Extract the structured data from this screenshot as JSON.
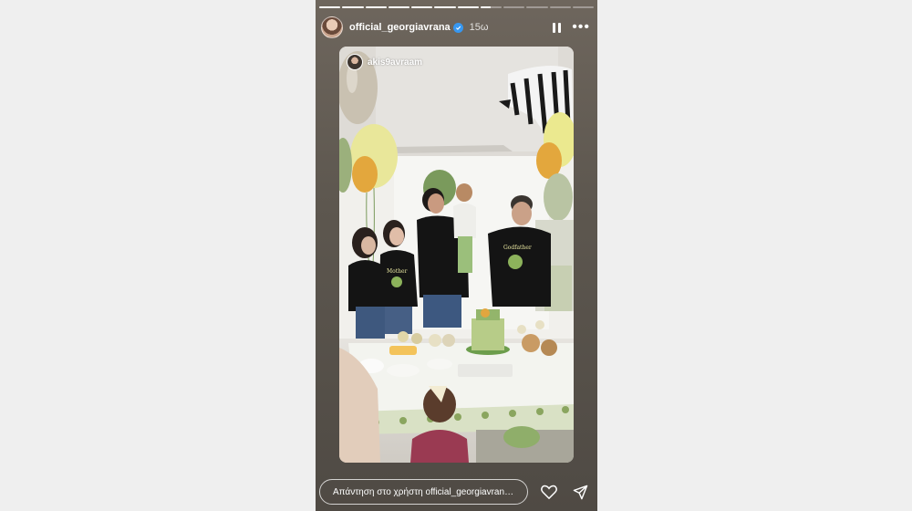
{
  "story": {
    "progress_segments": [
      1,
      1,
      1,
      1,
      1,
      1,
      1,
      0.5,
      0,
      0,
      0,
      0
    ],
    "username": "official_georgiavrana",
    "verified": true,
    "time": "15ω",
    "repost_user": "akis9avraam",
    "reply_placeholder": "Απάντηση στο χρήστη official_georgiavrana...",
    "icons": [
      "pause-icon",
      "more-icon",
      "heart-icon",
      "send-icon",
      "verified-badge-icon"
    ]
  },
  "photo": {
    "shirt_texts": [
      "Mother",
      "Godfather"
    ],
    "colors": {
      "balloon_yellow": "#e9e79a",
      "balloon_green": "#7a9a5c",
      "shirt": "#141414",
      "tablecloth": "#f3f4ef"
    }
  }
}
